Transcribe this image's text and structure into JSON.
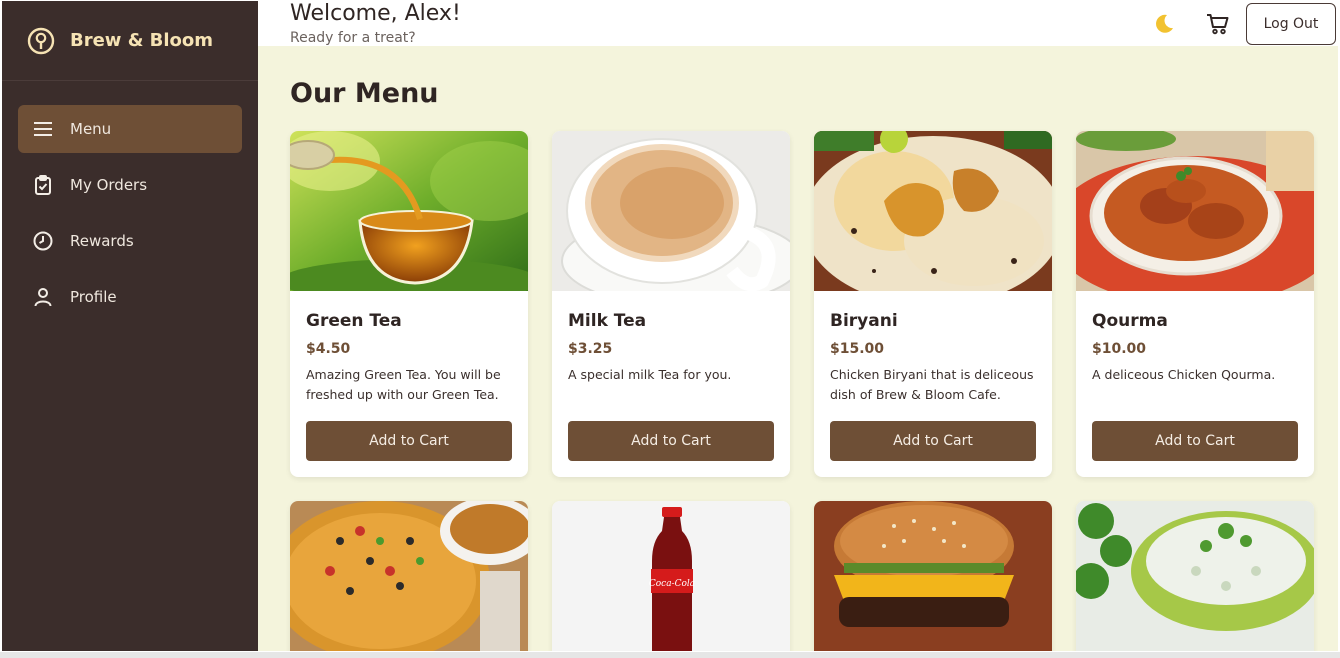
{
  "brand": {
    "name": "Brew & Bloom",
    "icon": "coffee-logo-icon"
  },
  "sidebar": {
    "items": [
      {
        "label": "Menu",
        "icon": "menu-icon",
        "active": true
      },
      {
        "label": "My Orders",
        "icon": "clipboard-icon",
        "active": false
      },
      {
        "label": "Rewards",
        "icon": "clock-icon",
        "active": false
      },
      {
        "label": "Profile",
        "icon": "user-icon",
        "active": false
      }
    ]
  },
  "header": {
    "welcome": "Welcome, Alex!",
    "subtitle": "Ready for a treat?",
    "theme_icon": "moon-icon",
    "cart_icon": "cart-icon",
    "logout_label": "Log Out"
  },
  "main": {
    "title": "Our Menu",
    "items": [
      {
        "name": "Green Tea",
        "price": "$4.50",
        "description": "Amazing Green Tea. You will be freshed up with our Green Tea.",
        "button": "Add to Cart"
      },
      {
        "name": "Milk Tea",
        "price": "$3.25",
        "description": "A special milk Tea for you.",
        "button": "Add to Cart"
      },
      {
        "name": "Biryani",
        "price": "$15.00",
        "description": "Chicken Biryani that is deliceous dish of Brew & Bloom Cafe.",
        "button": "Add to Cart"
      },
      {
        "name": "Qourma",
        "price": "$10.00",
        "description": "A deliceous Chicken Qourma.",
        "button": "Add to Cart"
      }
    ],
    "second_row": [
      "pizza-image",
      "cola-bottle-image",
      "burger-image",
      "salad-image"
    ]
  },
  "colors": {
    "sidebar_bg": "#3b2d2b",
    "active_item": "#6e4f36",
    "content_bg": "#f4f4dc",
    "accent": "#6e4f36",
    "brand_text": "#f6e3b4"
  }
}
